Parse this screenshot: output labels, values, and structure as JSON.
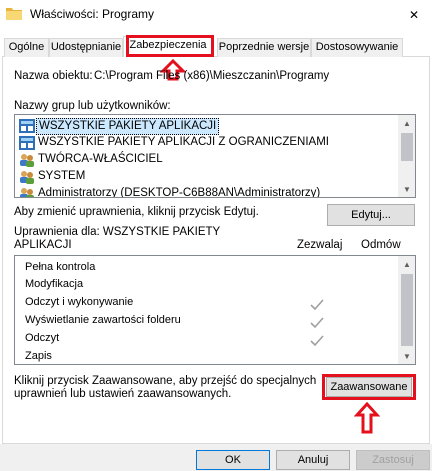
{
  "window": {
    "title": "Właściwości: Programy",
    "close_glyph": "✕"
  },
  "tabs": [
    {
      "label": "Ogólne",
      "active": false
    },
    {
      "label": "Udostępnianie",
      "active": false
    },
    {
      "label": "Zabezpieczenia",
      "active": true
    },
    {
      "label": "Poprzednie wersje",
      "active": false
    },
    {
      "label": "Dostosowywanie",
      "active": false
    }
  ],
  "security": {
    "object_label": "Nazwa obiektu:",
    "object_name": "C:\\Program Files (x86)\\Mieszczanin\\Programy",
    "groups_label": "Nazwy grup lub użytkowników:",
    "groups": [
      {
        "name": "WSZYSTKIE PAKIETY APLIKACJI",
        "icon": "app-package-icon",
        "selected": true
      },
      {
        "name": "WSZYSTKIE PAKIETY APLIKACJI Z OGRANICZENIAMI",
        "icon": "app-package-icon",
        "selected": false
      },
      {
        "name": "TWÓRCA-WŁAŚCICIEL",
        "icon": "users-group-icon",
        "selected": false
      },
      {
        "name": "SYSTEM",
        "icon": "users-group-icon",
        "selected": false
      },
      {
        "name": "Administratorzy (DESKTOP-C6B88AN\\Administratorzy)",
        "icon": "users-group-icon",
        "selected": false
      }
    ],
    "edit_hint": "Aby zmienić uprawnienia, kliknij przycisk Edytuj.",
    "edit_button": "Edytuj...",
    "permissions_for_line1": "Uprawnienia dla: WSZYSTKIE PAKIETY",
    "permissions_for_line2": "APLIKACJI",
    "allow_header": "Zezwalaj",
    "deny_header": "Odmów",
    "permissions": [
      {
        "name": "Pełna kontrola",
        "allow": false,
        "deny": false
      },
      {
        "name": "Modyfikacja",
        "allow": false,
        "deny": false
      },
      {
        "name": "Odczyt i wykonywanie",
        "allow": true,
        "deny": false
      },
      {
        "name": "Wyświetlanie zawartości folderu",
        "allow": true,
        "deny": false
      },
      {
        "name": "Odczyt",
        "allow": true,
        "deny": false
      },
      {
        "name": "Zapis",
        "allow": false,
        "deny": false
      }
    ],
    "advanced_hint_line1": "Kliknij przycisk Zaawansowane, aby przejść do specjalnych",
    "advanced_hint_line2": "uprawnień lub ustawień zaawansowanych.",
    "advanced_button": "Zaawansowane"
  },
  "footer": {
    "ok": "OK",
    "cancel": "Anuluj",
    "apply": "Zastosuj"
  },
  "colors": {
    "highlight": "#e4101d",
    "selection": "#cce8ff",
    "check": "#a0a0a0"
  }
}
